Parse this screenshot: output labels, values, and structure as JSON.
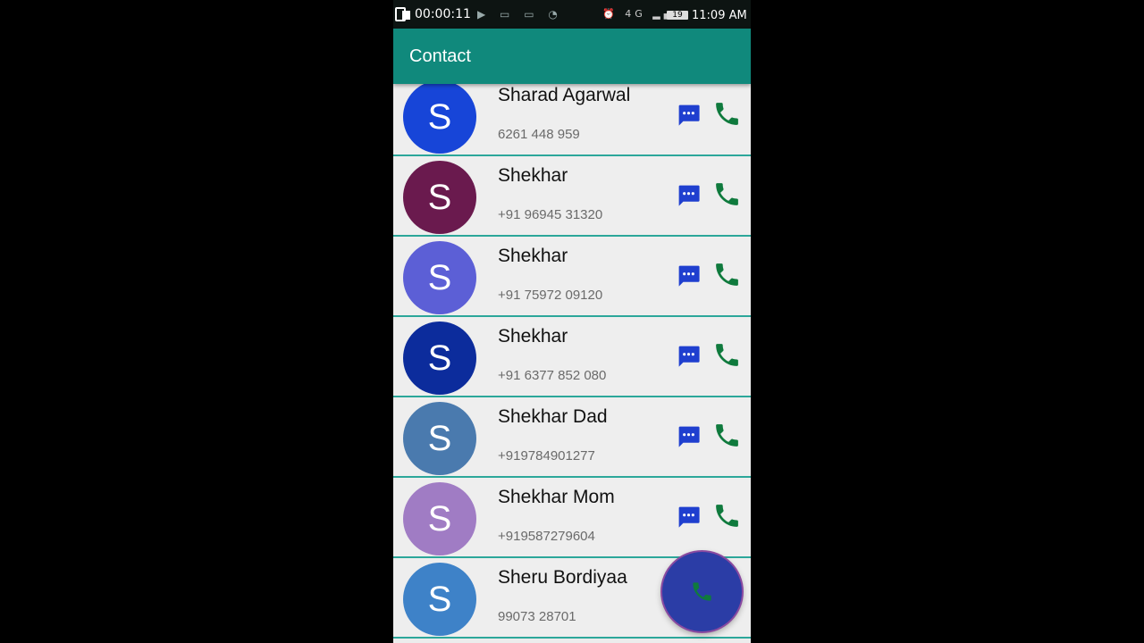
{
  "status_bar": {
    "recording_timer": "00:00:11",
    "battery": "19",
    "clock": "11:09 AM",
    "network": "4G"
  },
  "app_bar": {
    "title": "Contact"
  },
  "contacts": [
    {
      "initial": "S",
      "name": "Sharad Agarwal",
      "phone": "6261 448 959",
      "avatar_color": "#1745d8"
    },
    {
      "initial": "S",
      "name": "Shekhar",
      "phone": "+91 96945 31320",
      "avatar_color": "#6a1a4e"
    },
    {
      "initial": "S",
      "name": "Shekhar",
      "phone": "+91 75972 09120",
      "avatar_color": "#5c5fd6"
    },
    {
      "initial": "S",
      "name": "Shekhar",
      "phone": "+91 6377 852 080",
      "avatar_color": "#0c2c9c"
    },
    {
      "initial": "S",
      "name": "Shekhar Dad",
      "phone": "+919784901277",
      "avatar_color": "#4a7aae"
    },
    {
      "initial": "S",
      "name": "Shekhar Mom",
      "phone": "+919587279604",
      "avatar_color": "#a07cc4"
    },
    {
      "initial": "S",
      "name": "Sheru Bordiyaa",
      "phone": "99073 28701",
      "avatar_color": "#3e82c8"
    }
  ],
  "icons": {
    "message": "message-icon",
    "call": "phone-icon",
    "fab": "dial-phone-icon"
  },
  "colors": {
    "app_bar": "#10897c",
    "divider": "#2ca79a",
    "message_icon": "#1f3fcf",
    "call_icon": "#0f7a3d",
    "fab": "#2b3da6"
  }
}
